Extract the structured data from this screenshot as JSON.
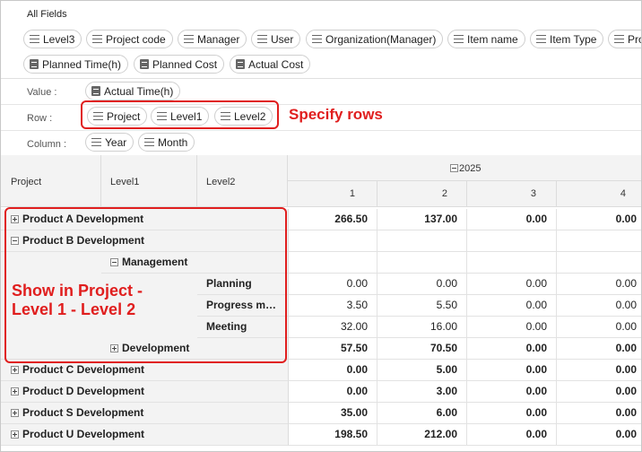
{
  "fields_panel": {
    "title": "All Fields",
    "fields": [
      {
        "label": "Level3",
        "icon": "list-icon"
      },
      {
        "label": "Project code",
        "icon": "list-icon"
      },
      {
        "label": "Manager",
        "icon": "list-icon"
      },
      {
        "label": "User",
        "icon": "list-icon"
      },
      {
        "label": "Organization(Manager)",
        "icon": "list-icon"
      },
      {
        "label": "Item name",
        "icon": "list-icon"
      },
      {
        "label": "Item Type",
        "icon": "list-icon"
      },
      {
        "label": "Pro",
        "icon": "list-icon"
      },
      {
        "label": "Planned Time(h)",
        "icon": "measure-icon"
      },
      {
        "label": "Planned Cost",
        "icon": "measure-icon"
      },
      {
        "label": "Actual Cost",
        "icon": "measure-icon"
      }
    ]
  },
  "zones": {
    "value": {
      "label": "Value",
      "fields": [
        "Actual Time(h)"
      ]
    },
    "row": {
      "label": "Row",
      "fields": [
        "Project",
        "Level1",
        "Level2"
      ]
    },
    "column": {
      "label": "Column",
      "fields": [
        "Year",
        "Month"
      ]
    }
  },
  "annotations": {
    "rows_callout": "Specify rows",
    "grid_callout_line1": "Show in Project -",
    "grid_callout_line2": "Level 1 - Level 2"
  },
  "grid": {
    "row_headers": [
      "Project",
      "Level1",
      "Level2"
    ],
    "year": "2025",
    "months": [
      "1",
      "2",
      "3",
      "4"
    ],
    "rows": [
      {
        "level": 0,
        "label": "Product A Development",
        "toggle": "plus",
        "bold": true,
        "values": [
          "266.50",
          "137.00",
          "0.00",
          "0.00"
        ]
      },
      {
        "level": 0,
        "label": "Product B Development",
        "toggle": "minus",
        "bold": true,
        "values": [
          "",
          "",
          "",
          ""
        ]
      },
      {
        "level": 1,
        "label": "Management",
        "toggle": "minus",
        "bold": true,
        "values": [
          "",
          "",
          "",
          ""
        ]
      },
      {
        "level": 2,
        "label": "Planning",
        "toggle": "none",
        "bold": false,
        "values": [
          "0.00",
          "0.00",
          "0.00",
          "0.00"
        ]
      },
      {
        "level": 2,
        "label": "Progress m…",
        "toggle": "none",
        "bold": false,
        "values": [
          "3.50",
          "5.50",
          "0.00",
          "0.00"
        ]
      },
      {
        "level": 2,
        "label": "Meeting",
        "toggle": "none",
        "bold": false,
        "values": [
          "32.00",
          "16.00",
          "0.00",
          "0.00"
        ]
      },
      {
        "level": 1,
        "label": "Development",
        "toggle": "plus",
        "bold": true,
        "values": [
          "57.50",
          "70.50",
          "0.00",
          "0.00"
        ]
      },
      {
        "level": 0,
        "label": "Product C Development",
        "toggle": "plus",
        "bold": true,
        "values": [
          "0.00",
          "5.00",
          "0.00",
          "0.00"
        ]
      },
      {
        "level": 0,
        "label": "Product D Development",
        "toggle": "plus",
        "bold": true,
        "values": [
          "0.00",
          "3.00",
          "0.00",
          "0.00"
        ]
      },
      {
        "level": 0,
        "label": "Product S Development",
        "toggle": "plus",
        "bold": true,
        "values": [
          "35.00",
          "6.00",
          "0.00",
          "0.00"
        ]
      },
      {
        "level": 0,
        "label": "Product U Development",
        "toggle": "plus",
        "bold": true,
        "values": [
          "198.50",
          "212.00",
          "0.00",
          "0.00"
        ]
      }
    ]
  },
  "colors": {
    "accent_red": "#e01e1e",
    "header_bg": "#f3f3f3"
  }
}
